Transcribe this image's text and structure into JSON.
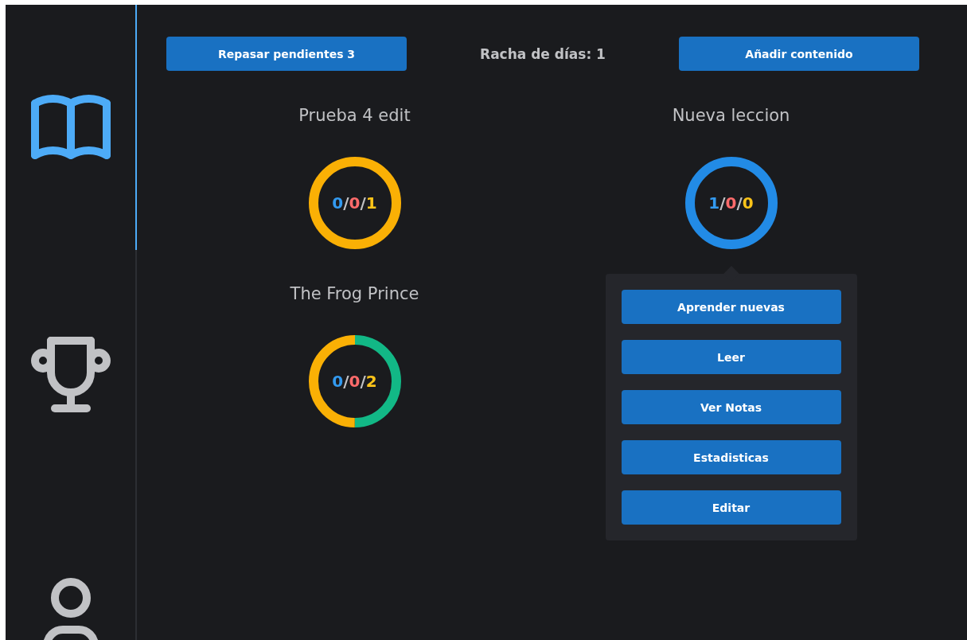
{
  "sidebar": {
    "items": [
      {
        "kind": "book",
        "selected": true
      },
      {
        "kind": "trophy",
        "selected": false
      },
      {
        "kind": "user",
        "selected": false
      }
    ]
  },
  "header": {
    "review_button": "Repasar pendientes 3",
    "streak": "Racha de días: 1",
    "add_button": "Añadir contenido"
  },
  "lessons": [
    {
      "title": "Prueba 4 edit",
      "separator": "/",
      "counts": [
        {
          "text": "0",
          "color": "#339af0"
        },
        {
          "text": "0",
          "color": "#ff6b6b"
        },
        {
          "text": "1",
          "color": "#fcc419"
        }
      ],
      "segments": [
        {
          "color": "#fab005"
        }
      ]
    },
    {
      "title": "Nueva leccion",
      "separator": "/",
      "counts": [
        {
          "text": "1",
          "color": "#339af0"
        },
        {
          "text": "0",
          "color": "#ff6b6b"
        },
        {
          "text": "0",
          "color": "#fcc419"
        }
      ],
      "segments": [
        {
          "color": "#228be6"
        }
      ],
      "menu_open": true
    },
    {
      "title": "The Frog Prince",
      "separator": "/",
      "counts": [
        {
          "text": "0",
          "color": "#339af0"
        },
        {
          "text": "0",
          "color": "#ff6b6b"
        },
        {
          "text": "2",
          "color": "#fcc419"
        }
      ],
      "segments": [
        {
          "color": "#12b886"
        },
        {
          "color": "#fab005"
        }
      ]
    }
  ],
  "menu": {
    "items": [
      "Aprender nuevas",
      "Leer",
      "Ver Notas",
      "Estadisticas",
      "Editar"
    ]
  }
}
